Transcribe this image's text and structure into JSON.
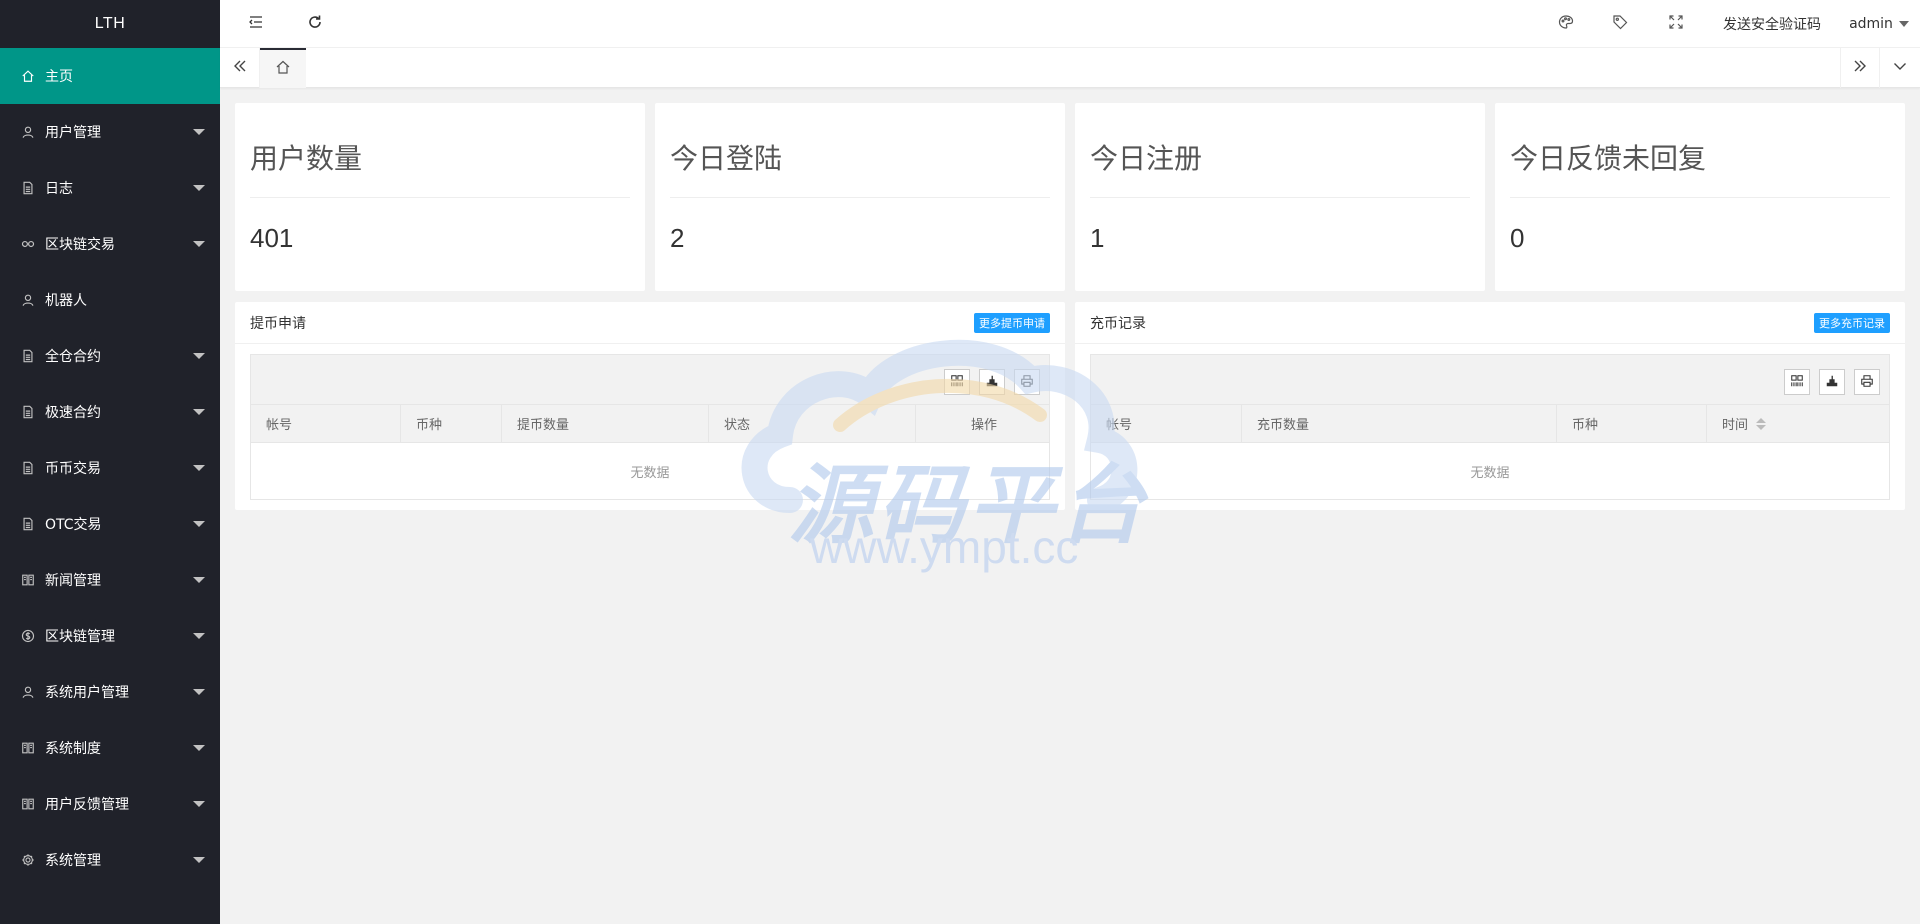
{
  "app": {
    "logo": "LTH"
  },
  "sidebar": {
    "items": [
      {
        "label": "主页",
        "icon": "home-icon",
        "active": true,
        "expandable": false
      },
      {
        "label": "用户管理",
        "icon": "user-icon",
        "expandable": true
      },
      {
        "label": "日志",
        "icon": "file-icon",
        "expandable": true
      },
      {
        "label": "区块链交易",
        "icon": "link-icon",
        "expandable": true
      },
      {
        "label": "机器人",
        "icon": "user-icon",
        "expandable": false
      },
      {
        "label": "全仓合约",
        "icon": "file-icon",
        "expandable": true
      },
      {
        "label": "极速合约",
        "icon": "file-icon",
        "expandable": true
      },
      {
        "label": "币币交易",
        "icon": "file-icon",
        "expandable": true
      },
      {
        "label": "OTC交易",
        "icon": "file-icon",
        "expandable": true
      },
      {
        "label": "新闻管理",
        "icon": "news-icon",
        "expandable": true
      },
      {
        "label": "区块链管理",
        "icon": "dollar-icon",
        "expandable": true
      },
      {
        "label": "系统用户管理",
        "icon": "user-icon",
        "expandable": true
      },
      {
        "label": "系统制度",
        "icon": "news-icon",
        "expandable": true
      },
      {
        "label": "用户反馈管理",
        "icon": "news-icon",
        "expandable": true
      },
      {
        "label": "系统管理",
        "icon": "gear-icon",
        "expandable": true
      }
    ]
  },
  "header": {
    "security_code_link": "发送安全验证码",
    "user": "admin"
  },
  "stats": [
    {
      "title": "用户数量",
      "value": "401"
    },
    {
      "title": "今日登陆",
      "value": "2"
    },
    {
      "title": "今日注册",
      "value": "1"
    },
    {
      "title": "今日反馈未回复",
      "value": "0"
    }
  ],
  "withdraw": {
    "title": "提币申请",
    "more_label": "更多提币申请",
    "columns": [
      "帐号",
      "币种",
      "提币数量",
      "状态",
      "操作"
    ],
    "empty_text": "无数据"
  },
  "deposit": {
    "title": "充币记录",
    "more_label": "更多充币记录",
    "columns": [
      "帐号",
      "充币数量",
      "币种",
      "时间"
    ],
    "empty_text": "无数据"
  },
  "watermark": {
    "main": "源码平台",
    "sub": "www.ympt.cc"
  },
  "colors": {
    "sidebar_bg": "#20222a",
    "active_nav": "#009688",
    "more_button": "#1e9fff"
  }
}
